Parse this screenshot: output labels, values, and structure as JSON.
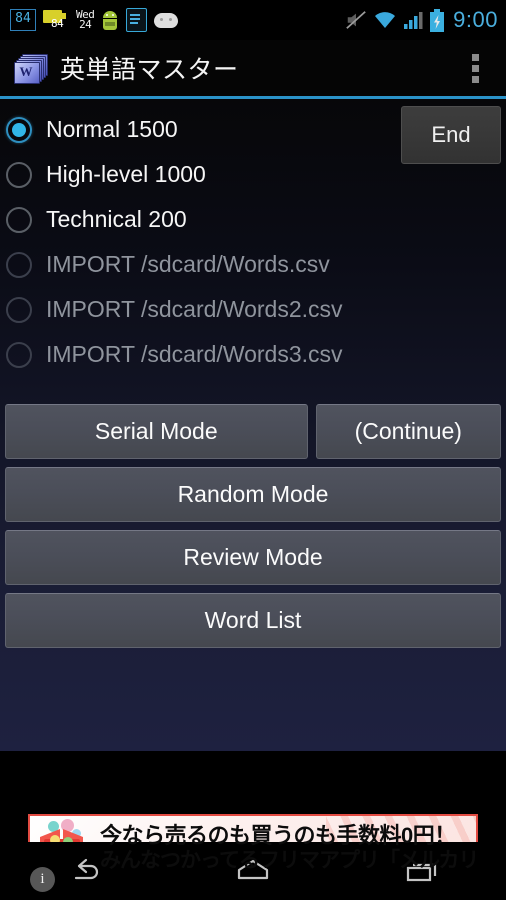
{
  "statusbar": {
    "battery_percent_box": "84",
    "battery_widget_value": "84",
    "calendar_day_name": "Wed",
    "calendar_day_number": "24",
    "clock": "9:00",
    "icons": [
      "battery-percent-icon",
      "battery-widget-icon",
      "calendar-icon",
      "android-robot-icon",
      "clipboard-icon",
      "bugdroid-icon",
      "mute-icon",
      "wifi-icon",
      "signal-icon",
      "battery-charging-icon"
    ],
    "accent_color": "#49b0e0"
  },
  "titlebar": {
    "app_title": "英単語マスター",
    "app_icon_letter": "W",
    "overflow_label": "",
    "divider_color": "#2b93c9"
  },
  "word_sets": {
    "options": [
      {
        "label": "Normal 1500",
        "selected": true,
        "disabled": false
      },
      {
        "label": "High-level 1000",
        "selected": false,
        "disabled": false
      },
      {
        "label": "Technical 200",
        "selected": false,
        "disabled": false
      },
      {
        "label": "IMPORT /sdcard/Words.csv",
        "selected": false,
        "disabled": true
      },
      {
        "label": "IMPORT /sdcard/Words2.csv",
        "selected": false,
        "disabled": true
      },
      {
        "label": "IMPORT /sdcard/Words3.csv",
        "selected": false,
        "disabled": true
      }
    ]
  },
  "end_button": {
    "label": "End"
  },
  "mode_buttons": {
    "serial": "Serial Mode",
    "continue": "(Continue)",
    "random": "Random Mode",
    "review": "Review Mode",
    "word_list": "Word List"
  },
  "ad": {
    "line1": "今なら売るのも買うのも手数料0円！",
    "line2": "みんなつかってるフリマアプリ「メルカリ」",
    "info_marker": "i",
    "border_color": "#e24b42"
  },
  "navbar": {
    "back_label": "back-button",
    "home_label": "home-button",
    "recents_label": "recents-button"
  },
  "theme": {
    "content_bg_top": "#070709",
    "content_bg_bottom": "#1e2140",
    "button_fill": "#4b4e59",
    "radio_selected": "#31b6e8"
  }
}
